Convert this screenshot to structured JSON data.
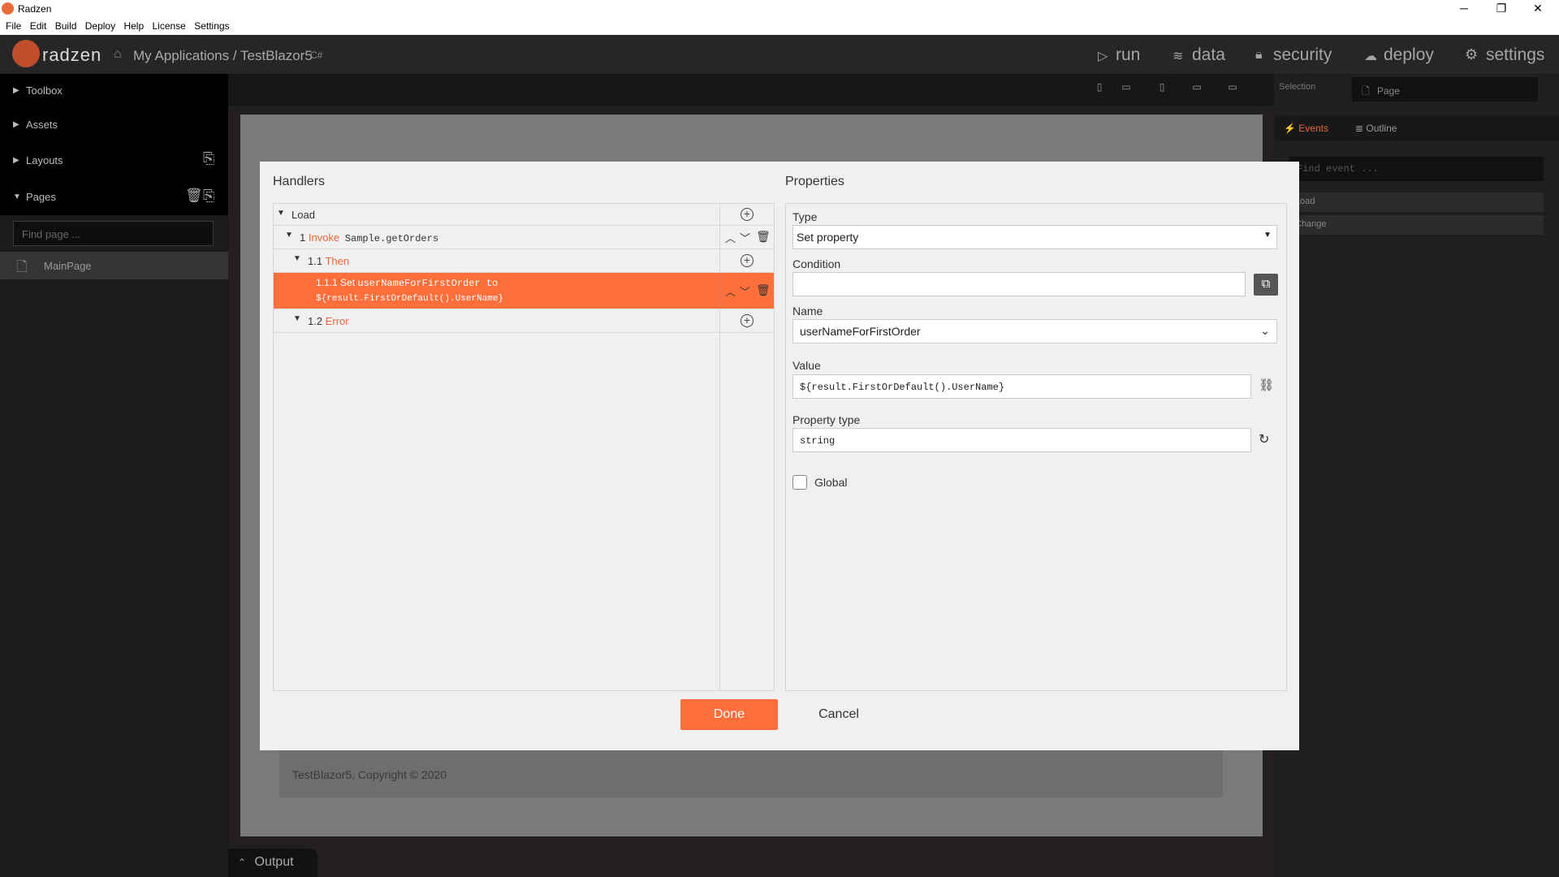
{
  "window": {
    "title": "Radzen",
    "minimize": "─",
    "maximize": "❐",
    "close": "✕"
  },
  "menu": [
    "File",
    "Edit",
    "Build",
    "Deploy",
    "Help",
    "License",
    "Settings"
  ],
  "topnav": {
    "brand": "radzen",
    "breadcrumb": "My Applications / TestBlazor5",
    "lang_badge": "C#",
    "items": {
      "run": "run",
      "data": "data",
      "security": "security",
      "deploy": "deploy",
      "settings": "settings"
    }
  },
  "sidebar": {
    "sections": {
      "toolbox": "Toolbox",
      "assets": "Assets",
      "layouts": "Layouts",
      "pages": "Pages"
    },
    "find_placeholder": "Find page ...",
    "pages": [
      "MainPage"
    ]
  },
  "right_panel": {
    "selection_label": "Selection",
    "selection_value": "Page",
    "tabs": {
      "events": "Events",
      "outline": "Outline"
    },
    "find_event_placeholder": "Find event ...",
    "events": [
      "Load",
      "Change"
    ]
  },
  "canvas": {
    "copyright": "TestBlazor5, Copyright © 2020",
    "output_label": "Output"
  },
  "dialog": {
    "handlers_title": "Handlers",
    "properties_title": "Properties",
    "tree": {
      "load": "Load",
      "invoke_num": "1",
      "invoke_kw": "Invoke",
      "invoke_target": "Sample.getOrders",
      "then_num": "1.1",
      "then_kw": "Then",
      "set_num": "1.1.1",
      "set_kw": "Set",
      "set_line1": "userNameForFirstOrder to",
      "set_line2": "${result.FirstOrDefault().UserName}",
      "error_num": "1.2",
      "error_kw": "Error"
    },
    "props": {
      "type_label": "Type",
      "type_value": "Set property",
      "condition_label": "Condition",
      "condition_value": "",
      "name_label": "Name",
      "name_value": "userNameForFirstOrder",
      "value_label": "Value",
      "value_value": "${result.FirstOrDefault().UserName}",
      "ptype_label": "Property type",
      "ptype_value": "string",
      "global_label": "Global",
      "global_checked": false
    },
    "done": "Done",
    "cancel": "Cancel"
  },
  "colors": {
    "accent": "#ff6f3c",
    "brand": "#e8683d"
  }
}
